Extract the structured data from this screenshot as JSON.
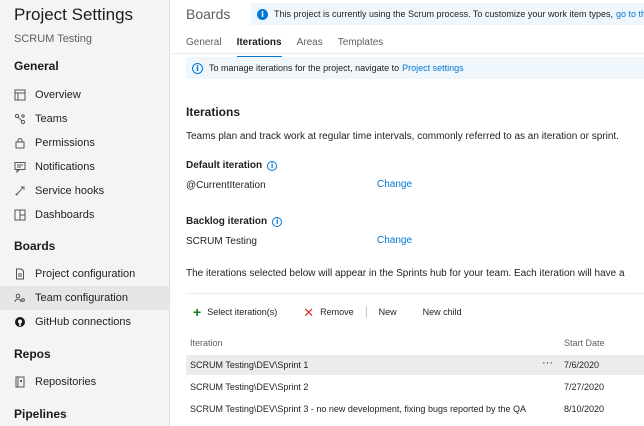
{
  "sidebar": {
    "title": "Project Settings",
    "project": "SCRUM Testing",
    "sections": [
      {
        "label": "General"
      },
      {
        "label": "Boards"
      },
      {
        "label": "Repos"
      },
      {
        "label": "Pipelines"
      }
    ],
    "items": [
      {
        "label": "Overview",
        "icon": "overview-icon"
      },
      {
        "label": "Teams",
        "icon": "teams-icon"
      },
      {
        "label": "Permissions",
        "icon": "lock-icon"
      },
      {
        "label": "Notifications",
        "icon": "notification-icon"
      },
      {
        "label": "Service hooks",
        "icon": "service-hooks-icon"
      },
      {
        "label": "Dashboards",
        "icon": "dashboard-icon"
      },
      {
        "label": "Project configuration",
        "icon": "document-icon"
      },
      {
        "label": "Team configuration",
        "icon": "team-config-icon",
        "selected": true
      },
      {
        "label": "GitHub connections",
        "icon": "github-icon"
      },
      {
        "label": "Repositories",
        "icon": "repository-icon"
      }
    ]
  },
  "header": {
    "title": "Boards",
    "banner_text": "This project is currently using the Scrum process. To customize your work item types,",
    "banner_link": "go to the"
  },
  "tabs": [
    {
      "label": "General"
    },
    {
      "label": "Iterations",
      "active": true
    },
    {
      "label": "Areas"
    },
    {
      "label": "Templates"
    }
  ],
  "info": {
    "text": "To manage iterations for the project, navigate to",
    "link": "Project settings"
  },
  "iterations": {
    "heading": "Iterations",
    "description": "Teams plan and track work at regular time intervals, commonly referred to as an iteration or sprint.",
    "default_label": "Default iteration",
    "default_value": "@CurrentIteration",
    "backlog_label": "Backlog iteration",
    "backlog_value": "SCRUM Testing",
    "change_label": "Change",
    "selected_note": "The iterations selected below will appear in the Sprints hub for your team. Each iteration will have a"
  },
  "commands": {
    "select": "Select iteration(s)",
    "remove": "Remove",
    "new": "New",
    "new_child": "New child"
  },
  "grid": {
    "columns": {
      "iteration": "Iteration",
      "start_date": "Start Date"
    },
    "rows": [
      {
        "iteration": "SCRUM Testing\\DEV\\Sprint 1",
        "start_date": "7/6/2020",
        "selected": true
      },
      {
        "iteration": "SCRUM Testing\\DEV\\Sprint 2",
        "start_date": "7/27/2020"
      },
      {
        "iteration": "SCRUM Testing\\DEV\\Sprint 3 - no new development, fixing bugs reported by the QA",
        "start_date": "8/10/2020"
      }
    ],
    "more_glyph": "···"
  },
  "colors": {
    "accent": "#0078d4",
    "add": "#107c10",
    "remove": "#d13438"
  }
}
